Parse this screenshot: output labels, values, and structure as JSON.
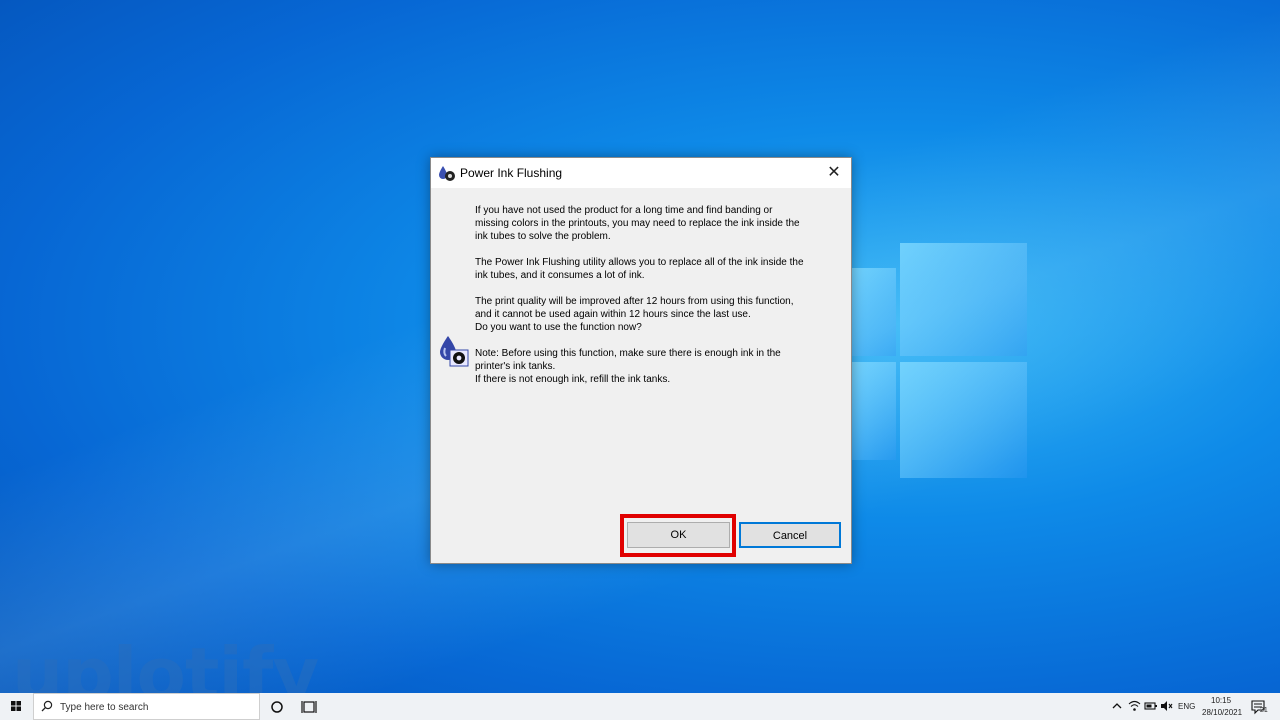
{
  "dialog": {
    "title": "Power Ink Flushing",
    "paragraphs": [
      "If you have not used the product for a long time and find banding or missing colors in the printouts, you may need to replace the ink inside the ink tubes to solve the problem.",
      "The Power Ink Flushing utility allows you to replace all of the ink inside the ink tubes, and it consumes a lot of ink.",
      "The print quality will be improved after 12 hours from using this function, and it cannot be used again within 12 hours since the last use.",
      "Do you want to use the function now?",
      "Note: Before using this function, make sure there is enough ink in the printer's ink tanks.",
      "If there is not enough ink, refill the ink tanks."
    ],
    "ok_label": "OK",
    "cancel_label": "Cancel"
  },
  "watermark": "uplotify",
  "taskbar": {
    "search_placeholder": "Type here to search",
    "language": "ENG",
    "time": "10:15",
    "date": "28/10/2021",
    "notification_count": "21"
  },
  "colors": {
    "highlight": "#e00000",
    "accent": "#0078d7"
  }
}
